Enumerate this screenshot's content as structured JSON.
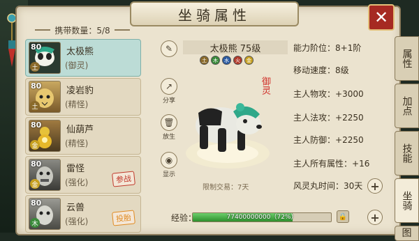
{
  "window": {
    "title": "坐骑属性",
    "close_icon": "close-icon"
  },
  "pet_list": {
    "carry_label": "携带数量：5/8",
    "items": [
      {
        "level": "80",
        "name": "太极熊",
        "type": "(御灵)",
        "element": "土",
        "selected": true
      },
      {
        "level": "80",
        "name": "凌岩豹",
        "type": "(精怪)",
        "element": "土",
        "selected": false
      },
      {
        "level": "80",
        "name": "仙葫芦",
        "type": "(精怪)",
        "element": "金",
        "selected": false
      },
      {
        "level": "80",
        "name": "雷怪",
        "type": "(强化)",
        "element": "金",
        "selected": false,
        "stamp": "参战"
      },
      {
        "level": "80",
        "name": "云兽",
        "type": "(强化)",
        "element": "木",
        "selected": false,
        "stamp": "投胎"
      }
    ]
  },
  "tools": {
    "share": "分享",
    "release": "放生",
    "display": "显示"
  },
  "detail": {
    "name_level": "太极熊  75级",
    "element_dots": [
      "土",
      "木",
      "水",
      "火",
      "金"
    ],
    "badge": "御灵",
    "trade_limit": "限制交易：7天"
  },
  "stats": [
    {
      "label": "能力阶位：",
      "value": "8+1阶"
    },
    {
      "label": "移动速度：",
      "value": "8级"
    },
    {
      "label": "主人物攻：",
      "value": "+3000"
    },
    {
      "label": "主人法攻：",
      "value": "+2250"
    },
    {
      "label": "主人防御：",
      "value": "+2250"
    },
    {
      "label": "主人所有属性：",
      "value": "+16"
    },
    {
      "label": "风灵丸时间：",
      "value": "30天"
    }
  ],
  "exp": {
    "label": "经验：",
    "text": "77400000000（72%）",
    "progress": 0.72
  },
  "tabs": [
    "属性",
    "加点",
    "技能",
    "坐骑",
    "图"
  ],
  "active_tab": 3,
  "colors": {
    "selected_row": "#bcdcd6",
    "close": "#a62a22",
    "exp_fill": "#2d8f2d",
    "stamp": "#c0392b"
  }
}
